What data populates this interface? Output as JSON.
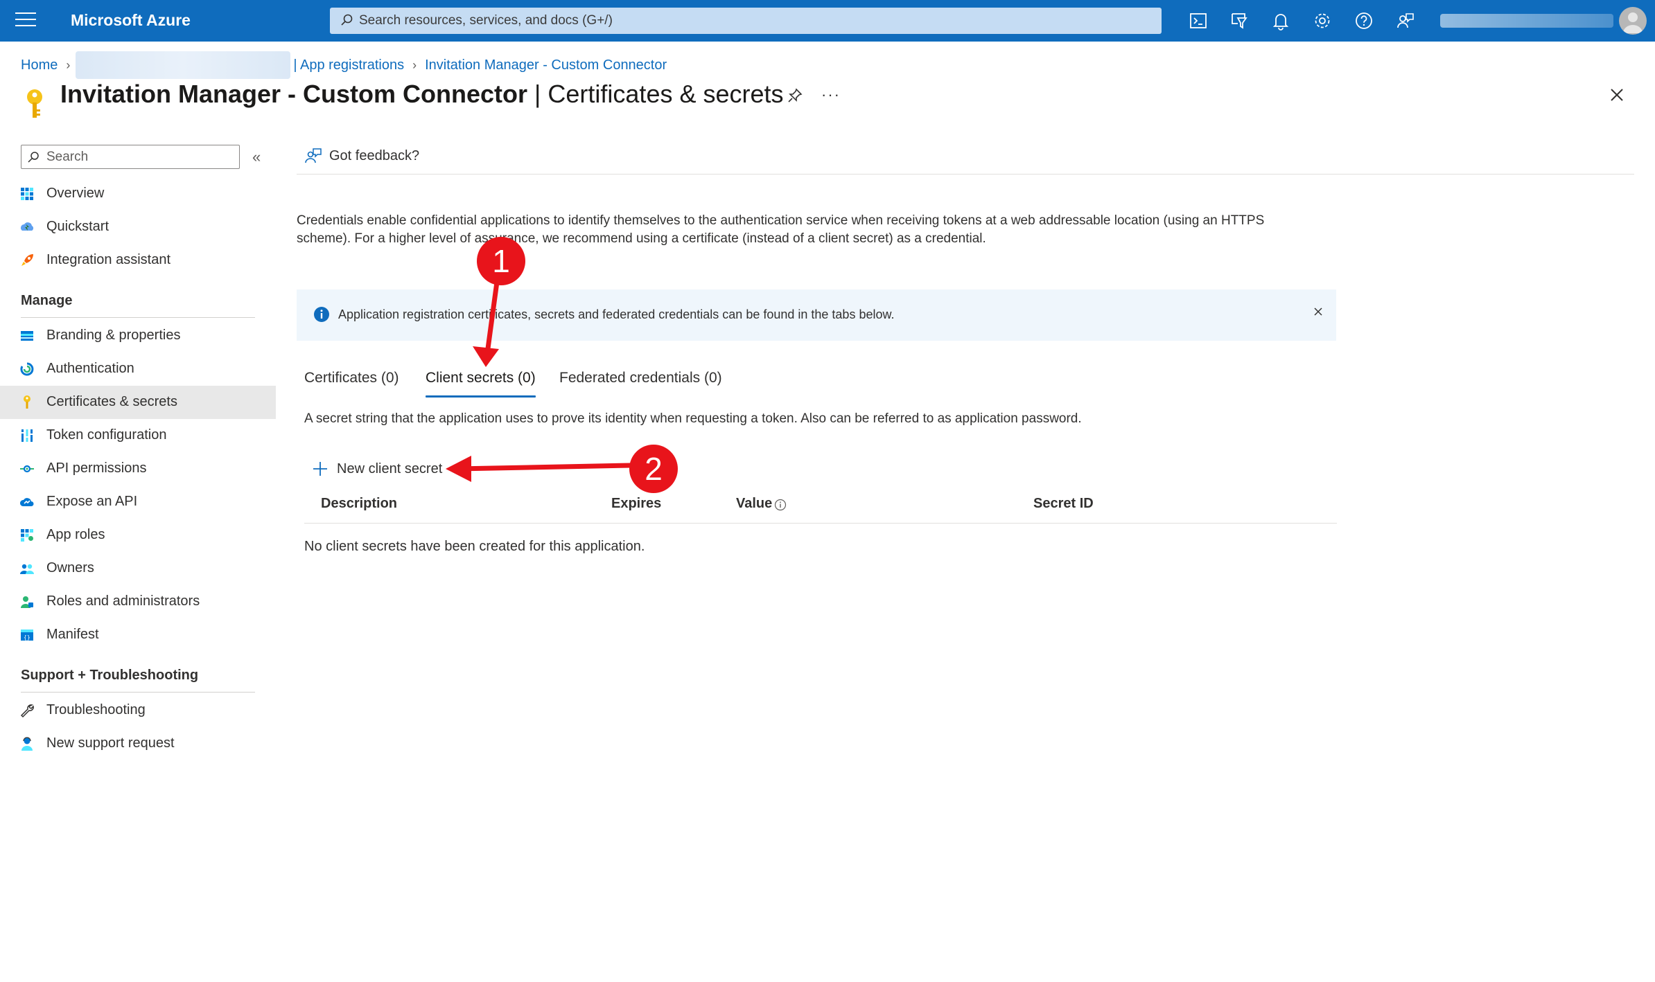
{
  "topbar": {
    "brand": "Microsoft Azure",
    "search_placeholder": "Search resources, services, and docs (G+/)",
    "icons": [
      "cloud-shell-icon",
      "directory-filter-icon",
      "notifications-icon",
      "settings-icon",
      "help-icon",
      "feedback-icon"
    ]
  },
  "breadcrumb": {
    "home": "Home",
    "app_registrations": "| App registrations",
    "current": "Invitation Manager - Custom Connector"
  },
  "header": {
    "title_app": "Invitation Manager - Custom Connector",
    "title_sep": " | ",
    "title_page": "Certificates & secrets",
    "more": "···"
  },
  "sidebar": {
    "search_placeholder": "Search",
    "collapse": "«",
    "top_items": [
      {
        "label": "Overview",
        "icon": "overview-icon"
      },
      {
        "label": "Quickstart",
        "icon": "quickstart-icon"
      },
      {
        "label": "Integration assistant",
        "icon": "rocket-icon"
      }
    ],
    "manage_title": "Manage",
    "manage_items": [
      {
        "label": "Branding & properties",
        "icon": "branding-icon"
      },
      {
        "label": "Authentication",
        "icon": "authentication-icon"
      },
      {
        "label": "Certificates & secrets",
        "icon": "key-icon"
      },
      {
        "label": "Token configuration",
        "icon": "token-icon"
      },
      {
        "label": "API permissions",
        "icon": "api-permissions-icon"
      },
      {
        "label": "Expose an API",
        "icon": "cloud-icon"
      },
      {
        "label": "App roles",
        "icon": "app-roles-icon"
      },
      {
        "label": "Owners",
        "icon": "owners-icon"
      },
      {
        "label": "Roles and administrators",
        "icon": "roles-icon"
      },
      {
        "label": "Manifest",
        "icon": "manifest-icon"
      }
    ],
    "support_title": "Support + Troubleshooting",
    "support_items": [
      {
        "label": "Troubleshooting",
        "icon": "wrench-icon"
      },
      {
        "label": "New support request",
        "icon": "support-icon"
      }
    ]
  },
  "content": {
    "feedback": "Got feedback?",
    "description_line1": "Credentials enable confidential applications to identify themselves to the authentication service when receiving tokens at a web addressable location (using an HTTPS",
    "description_line2": "scheme). For a higher level of assurance, we recommend using a certificate (instead of a client secret) as a credential.",
    "info_text": "Application registration certificates, secrets and federated credentials can be found in the tabs below.",
    "tabs": [
      "Certificates (0)",
      "Client secrets (0)",
      "Federated credentials (0)"
    ],
    "active_tab": "Client secrets (0)",
    "tab_description": "A secret string that the application uses to prove its identity when requesting a token. Also can be referred to as application password.",
    "new_secret": "New client secret",
    "columns": [
      "Description",
      "Expires",
      "Value",
      "Secret ID"
    ],
    "empty_message": "No client secrets have been created for this application."
  },
  "annotations": {
    "step1": "1",
    "step2": "2",
    "color": "#e8141b"
  }
}
